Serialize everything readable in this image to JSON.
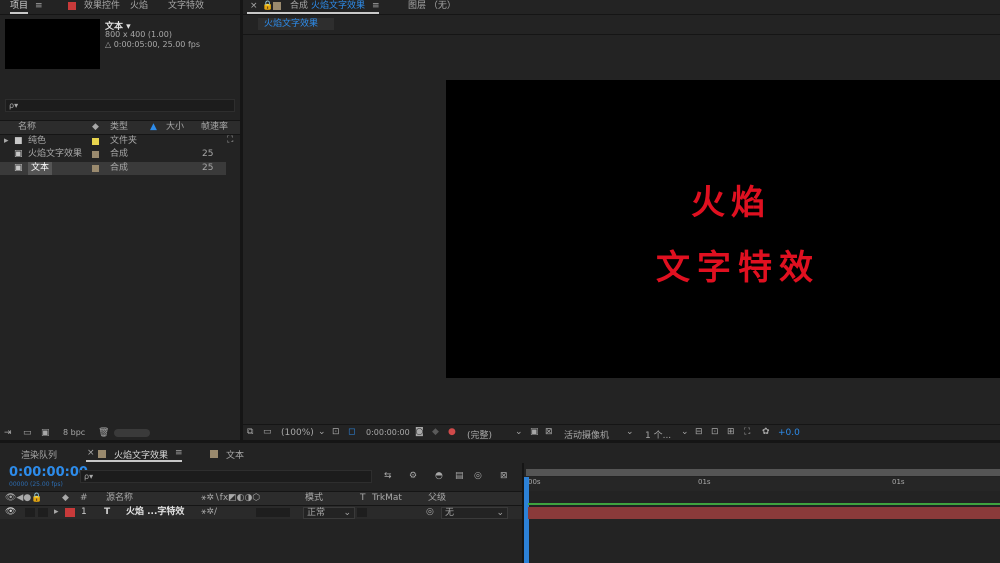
{
  "left_panel": {
    "tabs": [
      "项目",
      "效果控件",
      "火焰",
      "文字特效"
    ],
    "preview": {
      "name": "文本 ▾",
      "size": "800 x 400 (1.00)",
      "duration": "△ 0:00:05:00, 25.00 fps"
    },
    "search_placeholder": "ρ▾",
    "columns": [
      "名称",
      "类型",
      "大小",
      "帧速率"
    ],
    "items": [
      {
        "name": "纯色",
        "type": "文件夹",
        "fps": "",
        "label_color": "#e8d44d",
        "kind": "folder"
      },
      {
        "name": "火焰文字效果",
        "type": "合成",
        "fps": "25",
        "label_color": "#9a8a6e",
        "kind": "comp"
      },
      {
        "name": "文本",
        "type": "合成",
        "fps": "25",
        "label_color": "#9a8a6e",
        "kind": "comp"
      }
    ],
    "bpc": "8 bpc"
  },
  "viewer": {
    "tab_prefix": "合成",
    "tab_active": "火焰文字效果",
    "tab_layer": "图层  （无）",
    "sub_tab": "火焰文字效果",
    "canvas_text_line1": "火焰",
    "canvas_text_line2": "文字特效",
    "text_color": "#e01020",
    "toolbar": {
      "zoom": "(100%)",
      "time": "0:00:00:00",
      "quality": "(完整)",
      "camera": "活动摄像机",
      "views": "1 个...",
      "exposure": "+0.0"
    }
  },
  "timeline": {
    "tabs": [
      "渲染队列",
      "火焰文字效果",
      "文本"
    ],
    "timecode": "0:00:00:00",
    "frames": "00000 (25.00 fps)",
    "search_placeholder": "ρ▾",
    "ruler": [
      "00s",
      "01s",
      "01s"
    ],
    "columns": {
      "num": "#",
      "source": "源名称",
      "mode": "模式",
      "t": "T",
      "trkmat": "TrkMat",
      "parent": "父级"
    },
    "layer": {
      "num": "1",
      "type": "T",
      "name": "火焰 ...字特效",
      "mode": "正常",
      "parent": "无",
      "label_color": "#c83a3a"
    }
  }
}
